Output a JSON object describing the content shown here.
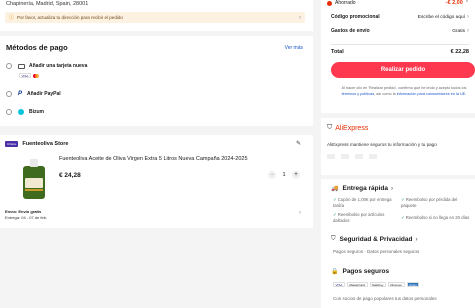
{
  "address": {
    "text": "Chapinería, Madrid, Spain, 28001",
    "warning": "Por favor, actualiza tu dirección para recibir el pedido"
  },
  "payment": {
    "title": "Métodos de pago",
    "see_more": "Ver más",
    "methods": [
      {
        "label": "Añadir una tarjeta nueva",
        "icon": "card-icon"
      },
      {
        "label": "Añadir PayPal",
        "icon": "paypal-icon"
      },
      {
        "label": "Bizum",
        "icon": "bizum-icon"
      }
    ],
    "card_logos": [
      "VISA",
      "MC"
    ]
  },
  "store": {
    "badge": "Choice",
    "name": "Fuenteoliva Store",
    "product_title": "Fuenteoliva Aceite de Oliva Virgen Extra 5 Litros Nueva Campaña 2024-2025",
    "price": "€ 24,28",
    "quantity": "1",
    "shipping_label": "Envío: Envío gratis",
    "delivery": "Entrega: 04 - 07 de feb."
  },
  "summary": {
    "savings_label": "Ahorrado",
    "savings_value": "-€ 2,00",
    "promo_label": "Código promocional",
    "promo_value": "Escribe el código aquí",
    "shipping_label": "Gastos de envío",
    "shipping_value": "Gratis",
    "total_label": "Total",
    "total_value": "€ 22,28",
    "order_button": "Realizar pedido",
    "legal_prefix": "Al hacer clic en 'Realizar pedido', confirmo que he leído y acepto todos los",
    "legal_link1": "términos y políticas",
    "legal_mid": ", así como la",
    "legal_link2": "información para consumidores en la UE."
  },
  "trust": {
    "brand": "AliExpress",
    "tagline": "AliExpress mantiene seguros tu información y tu pago",
    "delivery_title": "Entrega rápida",
    "delivery_items": [
      "Cupón de 1,00€ por entrega tardía",
      "Reembolso por pérdida del paquete",
      "Reembolso por artículos dañados",
      "Reembolso si no llega en 20 días"
    ],
    "security_title": "Seguridad & Privacidad",
    "security_text": "Pagos seguros · Datos personales seguros",
    "payments_title": "Pagos seguros",
    "payment_logos": [
      "VISA",
      "MasterCard",
      "SafeKey",
      "Discover",
      "Amex"
    ],
    "payments_text": "Con socios de pago populares tus datos personales"
  },
  "colors": {
    "accent": "#fd384f",
    "savings": "#e62e04",
    "link": "#1a56c8"
  }
}
